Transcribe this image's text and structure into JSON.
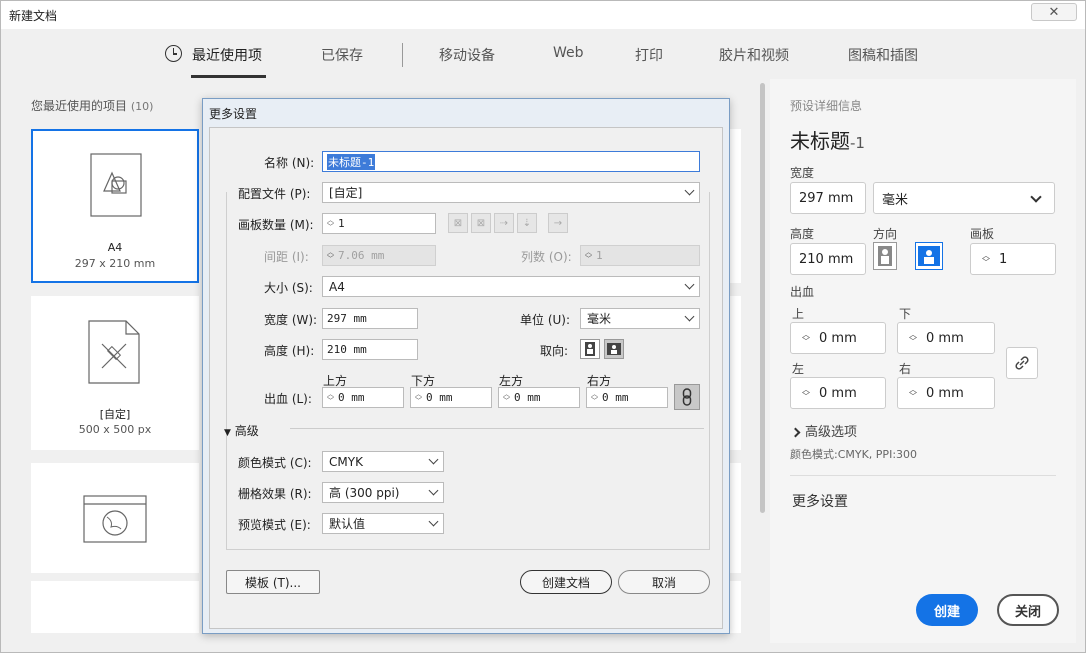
{
  "window": {
    "title": "新建文档",
    "close_icon": "close-icon"
  },
  "tabs": [
    {
      "label": "最近使用项"
    },
    {
      "label": "已保存"
    },
    {
      "label": "移动设备"
    },
    {
      "label": "Web"
    },
    {
      "label": "打印"
    },
    {
      "label": "胶片和视频"
    },
    {
      "label": "图稿和插图"
    }
  ],
  "recent": {
    "label": "您最近使用的项目",
    "count": "(10)",
    "items": [
      {
        "name": "A4",
        "size": "297 x 210 mm"
      },
      {
        "name": "[自定]",
        "size": "500 x 500 px"
      }
    ]
  },
  "preset": {
    "header": "预设详细信息",
    "title": "未标题",
    "title_suffix": "-1",
    "width_label": "宽度",
    "width_value": "297 mm",
    "unit_value": "毫米",
    "height_label": "高度",
    "height_value": "210 mm",
    "orientation_label": "方向",
    "artboard_label": "画板",
    "artboard_value": "1",
    "bleed_label": "出血",
    "top_label": "上",
    "top_value": "0 mm",
    "bottom_label": "下",
    "bottom_value": "0 mm",
    "left_label": "左",
    "left_value": "0 mm",
    "right_label": "右",
    "right_value": "0 mm",
    "advanced_label": "高级选项",
    "color_mode_info": "颜色模式:CMYK, PPI:300",
    "more_settings": "更多设置",
    "create_label": "创建",
    "close_label": "关闭"
  },
  "dialog": {
    "title": "更多设置",
    "name_label": "名称 (N):",
    "name_value": "未标题-1",
    "profile_label": "配置文件 (P):",
    "profile_value": "[自定]",
    "artboard_count_label": "画板数量 (M):",
    "artboard_count_value": "1",
    "spacing_label": "间距 (I):",
    "spacing_value": "7.06 mm",
    "columns_label": "列数 (O):",
    "columns_value": "1",
    "size_label": "大小 (S):",
    "size_value": "A4",
    "width_label": "宽度 (W):",
    "width_value": "297 mm",
    "unit_label": "单位 (U):",
    "unit_value": "毫米",
    "height_label": "高度 (H):",
    "height_value": "210 mm",
    "orientation_label": "取向:",
    "bleed_label": "出血 (L):",
    "bleed_top_label": "上方",
    "bleed_bottom_label": "下方",
    "bleed_left_label": "左方",
    "bleed_right_label": "右方",
    "bleed_top_value": "0 mm",
    "bleed_bottom_value": "0 mm",
    "bleed_left_value": "0 mm",
    "bleed_right_value": "0 mm",
    "advanced_label": "高级",
    "color_mode_label": "颜色模式 (C):",
    "color_mode_value": "CMYK",
    "raster_label": "栅格效果 (R):",
    "raster_value": "高 (300 ppi)",
    "preview_label": "预览模式 (E):",
    "preview_value": "默认值",
    "template_button": "模板 (T)...",
    "create_button": "创建文档",
    "cancel_button": "取消"
  },
  "colors": {
    "accent": "#1473e6"
  }
}
